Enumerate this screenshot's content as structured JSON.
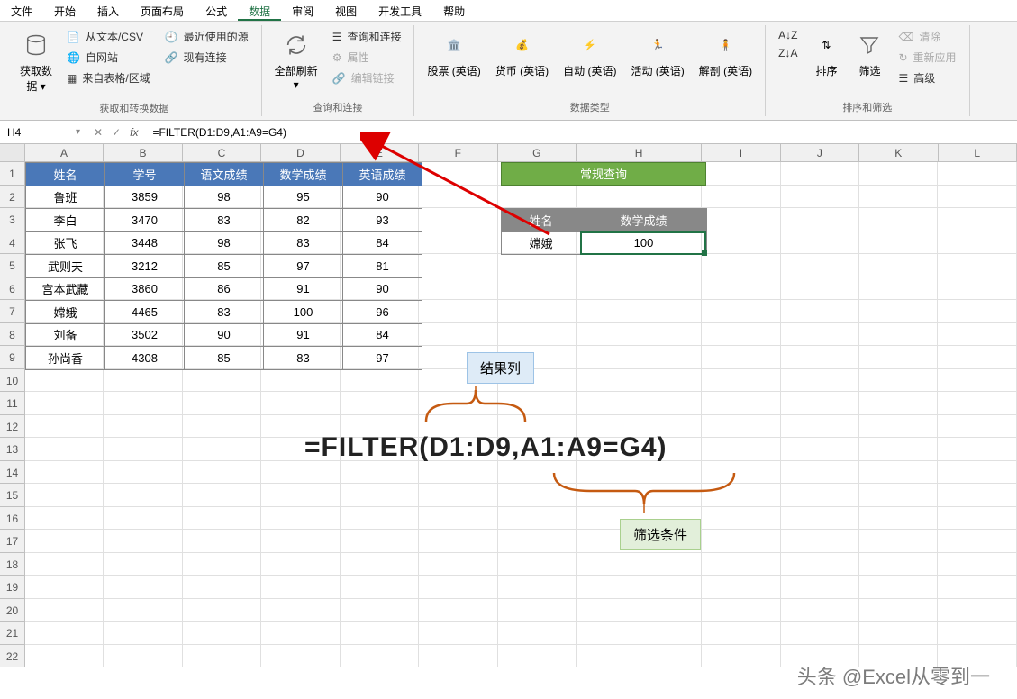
{
  "menu": [
    "文件",
    "开始",
    "插入",
    "页面布局",
    "公式",
    "数据",
    "审阅",
    "视图",
    "开发工具",
    "帮助"
  ],
  "menu_active": 5,
  "ribbon": {
    "g1": {
      "get_data": "获取数\n据 ▾",
      "items": [
        "从文本/CSV",
        "自网站",
        "来自表格/区域",
        "最近使用的源",
        "现有连接"
      ],
      "label": "获取和转换数据"
    },
    "g2": {
      "refresh": "全部刷新\n▾",
      "items": [
        "查询和连接",
        "属性",
        "编辑链接"
      ],
      "label": "查询和连接"
    },
    "g3": {
      "items": [
        "股票 (英语)",
        "货币 (英语)",
        "自动 (英语)",
        "活动 (英语)",
        "解剖 (英语)"
      ],
      "label": "数据类型"
    },
    "g4": {
      "sort_az": "A↓Z",
      "sort_za": "Z↓A",
      "sort": "排序",
      "filter": "筛选",
      "clear": "清除",
      "reapply": "重新应用",
      "advanced": "高级",
      "label": "排序和筛选"
    }
  },
  "namebox": "H4",
  "formula": "=FILTER(D1:D9,A1:A9=G4)",
  "cols": [
    "A",
    "B",
    "C",
    "D",
    "E",
    "F",
    "G",
    "H",
    "I",
    "J",
    "K",
    "L"
  ],
  "rows": [
    "1",
    "2",
    "3",
    "4",
    "5",
    "6",
    "7",
    "8",
    "9",
    "10",
    "11",
    "12",
    "13",
    "14",
    "15",
    "16",
    "17",
    "18",
    "19",
    "20",
    "21",
    "22"
  ],
  "table": {
    "headers": [
      "姓名",
      "学号",
      "语文成绩",
      "数学成绩",
      "英语成绩"
    ],
    "rows": [
      [
        "鲁班",
        "3859",
        "98",
        "95",
        "90"
      ],
      [
        "李白",
        "3470",
        "83",
        "82",
        "93"
      ],
      [
        "张飞",
        "3448",
        "98",
        "83",
        "84"
      ],
      [
        "武则天",
        "3212",
        "85",
        "97",
        "81"
      ],
      [
        "宫本武藏",
        "3860",
        "86",
        "91",
        "90"
      ],
      [
        "嫦娥",
        "4465",
        "83",
        "100",
        "96"
      ],
      [
        "刘备",
        "3502",
        "90",
        "91",
        "84"
      ],
      [
        "孙尚香",
        "4308",
        "85",
        "83",
        "97"
      ]
    ]
  },
  "query": {
    "title": "常规查询",
    "headers": [
      "姓名",
      "数学成绩"
    ],
    "row": [
      "嫦娥",
      "100"
    ]
  },
  "annot": {
    "result_col": "结果列",
    "filter_cond": "筛选条件",
    "big": "=FILTER(D1:D9,A1:A9=G4)"
  },
  "watermark": "头条 @Excel从零到一"
}
